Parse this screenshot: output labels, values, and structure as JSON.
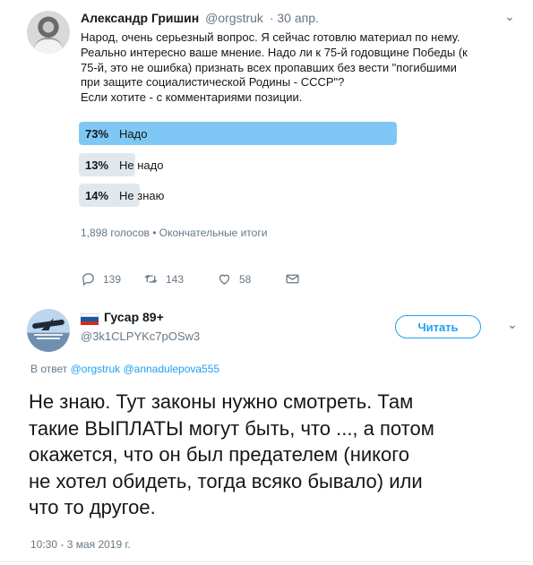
{
  "tweet1": {
    "author_name": "Александр Гришин",
    "author_handle": "@orgstruk",
    "date": "· 30 апр.",
    "text_lines": [
      "Народ, очень серьезный вопрос. Я сейчас готовлю материал по нему.",
      "Реально интересно ваше мнение. Надо ли к 75-й годовщине Победы (к",
      "75-й, это не ошибка) признать всех пропавших без вести \"погибшими",
      "при защите социалистической Родины - СССР\"?",
      "Если хотите - с комментариями позиции."
    ],
    "poll": {
      "options": [
        {
          "percent_label": "73%",
          "label": "Надо",
          "percent": 73
        },
        {
          "percent_label": "13%",
          "label": "Не надо",
          "percent": 13
        },
        {
          "percent_label": "14%",
          "label": "Не знаю",
          "percent": 14
        }
      ],
      "meta": "1,898 голосов • Окончательные итоги"
    },
    "actions": {
      "replies": "139",
      "retweets": "143",
      "likes": "58"
    }
  },
  "tweet2": {
    "author_name": "Гусар 89+",
    "author_handle": "@3k1CLPYKc7pOSw3",
    "follow_label": "Читать",
    "reply_prefix": "В ответ",
    "reply_mentions": "@orgstruk @annadulepova555",
    "text_lines": [
      "Не знаю. Тут законы нужно смотреть. Там",
      "такие ВЫПЛАТЫ могут быть, что ..., а потом",
      "окажется, что он был предателем (никого",
      "не хотел обидеть, тогда всяко бывало) или",
      "что то другое."
    ],
    "timestamp": "10:30 - 3 мая 2019 г."
  },
  "colors": {
    "accent": "#1da1f2",
    "poll_winner": "#7fc8f5",
    "poll_other": "#e1e8ed",
    "muted": "#657786"
  },
  "icons": [
    "reply-icon",
    "retweet-icon",
    "like-icon",
    "dm-icon",
    "caret-down-icon",
    "russian-flag-icon"
  ]
}
